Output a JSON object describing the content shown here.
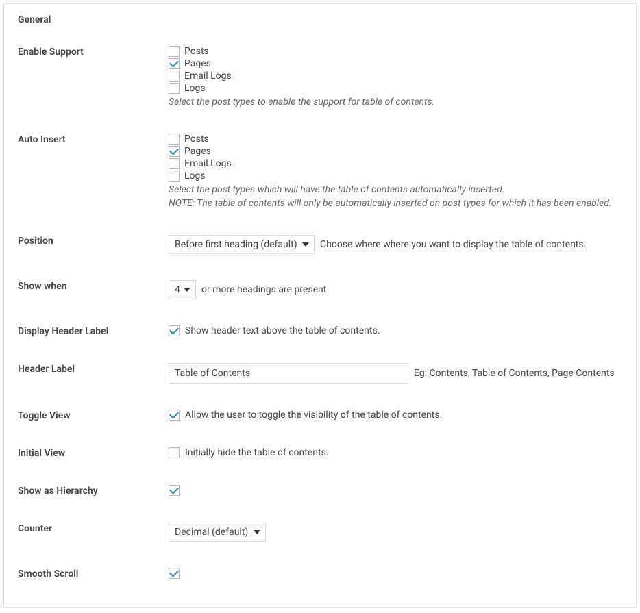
{
  "sectionTitle": "General",
  "enableSupport": {
    "label": "Enable Support",
    "options": [
      {
        "label": "Posts",
        "checked": false
      },
      {
        "label": "Pages",
        "checked": true
      },
      {
        "label": "Email Logs",
        "checked": false
      },
      {
        "label": "Logs",
        "checked": false
      }
    ],
    "description": "Select the post types to enable the support for table of contents."
  },
  "autoInsert": {
    "label": "Auto Insert",
    "options": [
      {
        "label": "Posts",
        "checked": false
      },
      {
        "label": "Pages",
        "checked": true
      },
      {
        "label": "Email Logs",
        "checked": false
      },
      {
        "label": "Logs",
        "checked": false
      }
    ],
    "description": "Select the post types which will have the table of contents automatically inserted.",
    "note": "NOTE: The table of contents will only be automatically inserted on post types for which it has been enabled."
  },
  "position": {
    "label": "Position",
    "selected": "Before first heading (default)",
    "help": "Choose where where you want to display the table of contents."
  },
  "showWhen": {
    "label": "Show when",
    "selected": "4",
    "suffix": "or more headings are present"
  },
  "displayHeaderLabel": {
    "label": "Display Header Label",
    "checked": true,
    "text": "Show header text above the table of contents."
  },
  "headerLabel": {
    "label": "Header Label",
    "value": "Table of Contents",
    "help": "Eg: Contents, Table of Contents, Page Contents"
  },
  "toggleView": {
    "label": "Toggle View",
    "checked": true,
    "text": "Allow the user to toggle the visibility of the table of contents."
  },
  "initialView": {
    "label": "Initial View",
    "checked": false,
    "text": "Initially hide the table of contents."
  },
  "showHierarchy": {
    "label": "Show as Hierarchy",
    "checked": true
  },
  "counter": {
    "label": "Counter",
    "selected": "Decimal (default)"
  },
  "smoothScroll": {
    "label": "Smooth Scroll",
    "checked": true
  }
}
